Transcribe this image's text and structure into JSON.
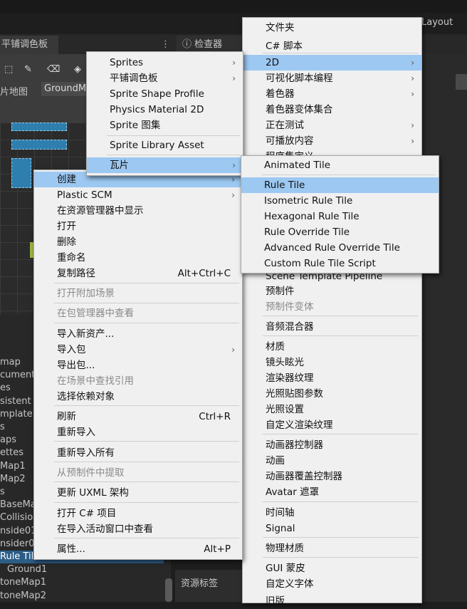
{
  "background": {
    "layout_label": "Layout",
    "tab_palette": "平铺调色板",
    "tab_inspector": "检查器",
    "tilemap_label": "片地图",
    "tilemap_value": "GroundM",
    "assets_label": "资源标签",
    "project_items": [
      "map",
      "cument",
      "es",
      "sistent",
      "mplate",
      "s",
      "aps",
      "ettes",
      "Map1",
      "Map2",
      "s",
      "BaseMa",
      "Collisio",
      "nside01",
      "nsider0",
      "Rule Tile",
      "Ground1",
      "toneMap1",
      "toneMap2"
    ]
  },
  "menu_main": {
    "items": [
      {
        "label": "创建",
        "arrow": "›",
        "selected": true
      },
      {
        "label": "Plastic SCM",
        "arrow": "›"
      },
      {
        "label": "在资源管理器中显示"
      },
      {
        "label": "打开"
      },
      {
        "label": "删除"
      },
      {
        "label": "重命名"
      },
      {
        "label": "复制路径",
        "shortcut": "Alt+Ctrl+C"
      },
      {
        "label": "打开附加场景",
        "disabled": true
      },
      {
        "label": "在包管理器中查看",
        "disabled": true
      },
      {
        "label": "导入新资产..."
      },
      {
        "label": "导入包",
        "arrow": "›"
      },
      {
        "label": "导出包..."
      },
      {
        "label": "在场景中查找引用",
        "disabled": true
      },
      {
        "label": "选择依赖对象"
      },
      {
        "label": "刷新",
        "shortcut": "Ctrl+R"
      },
      {
        "label": "重新导入"
      },
      {
        "label": "重新导入所有"
      },
      {
        "label": "从预制件中提取",
        "disabled": true
      },
      {
        "label": "更新 UXML 架构"
      },
      {
        "label": "打开 C# 项目"
      },
      {
        "label": "在导入活动窗口中查看"
      },
      {
        "label": "属性...",
        "shortcut": "Alt+P"
      }
    ]
  },
  "menu_2d": {
    "items": [
      {
        "label": "Sprites",
        "arrow": "›"
      },
      {
        "label": "平铺调色板",
        "arrow": "›"
      },
      {
        "label": "Sprite Shape Profile"
      },
      {
        "label": "Physics Material 2D"
      },
      {
        "label": "Sprite 图集"
      },
      {
        "label": "Sprite Library Asset"
      },
      {
        "label": "瓦片",
        "arrow": "›",
        "selected": true
      }
    ]
  },
  "menu_create": {
    "items": [
      {
        "label": "文件夹"
      },
      {
        "label": "C# 脚本"
      },
      {
        "label": "2D",
        "arrow": "›",
        "selected": true
      },
      {
        "label": "可视化脚本编程",
        "arrow": "›"
      },
      {
        "label": "着色器",
        "arrow": "›"
      },
      {
        "label": "着色器变体集合"
      },
      {
        "label": "正在测试",
        "arrow": "›"
      },
      {
        "label": "可播放内容",
        "arrow": "›"
      },
      {
        "label": "程序集定义"
      },
      {
        "label": "Scene Template Pipeline"
      },
      {
        "label": "预制件"
      },
      {
        "label": "预制件变体",
        "disabled": true
      },
      {
        "label": "音频混合器"
      },
      {
        "label": "材质"
      },
      {
        "label": "镜头眩光"
      },
      {
        "label": "渲染器纹理"
      },
      {
        "label": "光照贴图参数"
      },
      {
        "label": "光照设置"
      },
      {
        "label": "自定义渲染纹理"
      },
      {
        "label": "动画器控制器"
      },
      {
        "label": "动画"
      },
      {
        "label": "动画器覆盖控制器"
      },
      {
        "label": "Avatar 遮罩"
      },
      {
        "label": "时间轴"
      },
      {
        "label": "Signal"
      },
      {
        "label": "物理材质"
      },
      {
        "label": "GUI 蒙皮"
      },
      {
        "label": "自定义字体"
      },
      {
        "label": "旧版"
      }
    ]
  },
  "menu_tiles": {
    "items": [
      {
        "label": "Animated Tile"
      },
      {
        "label": "Rule Tile",
        "selected": true
      },
      {
        "label": "Isometric Rule Tile"
      },
      {
        "label": "Hexagonal Rule Tile"
      },
      {
        "label": "Rule Override Tile"
      },
      {
        "label": "Advanced Rule Override Tile"
      },
      {
        "label": "Custom Rule Tile Script"
      }
    ]
  }
}
